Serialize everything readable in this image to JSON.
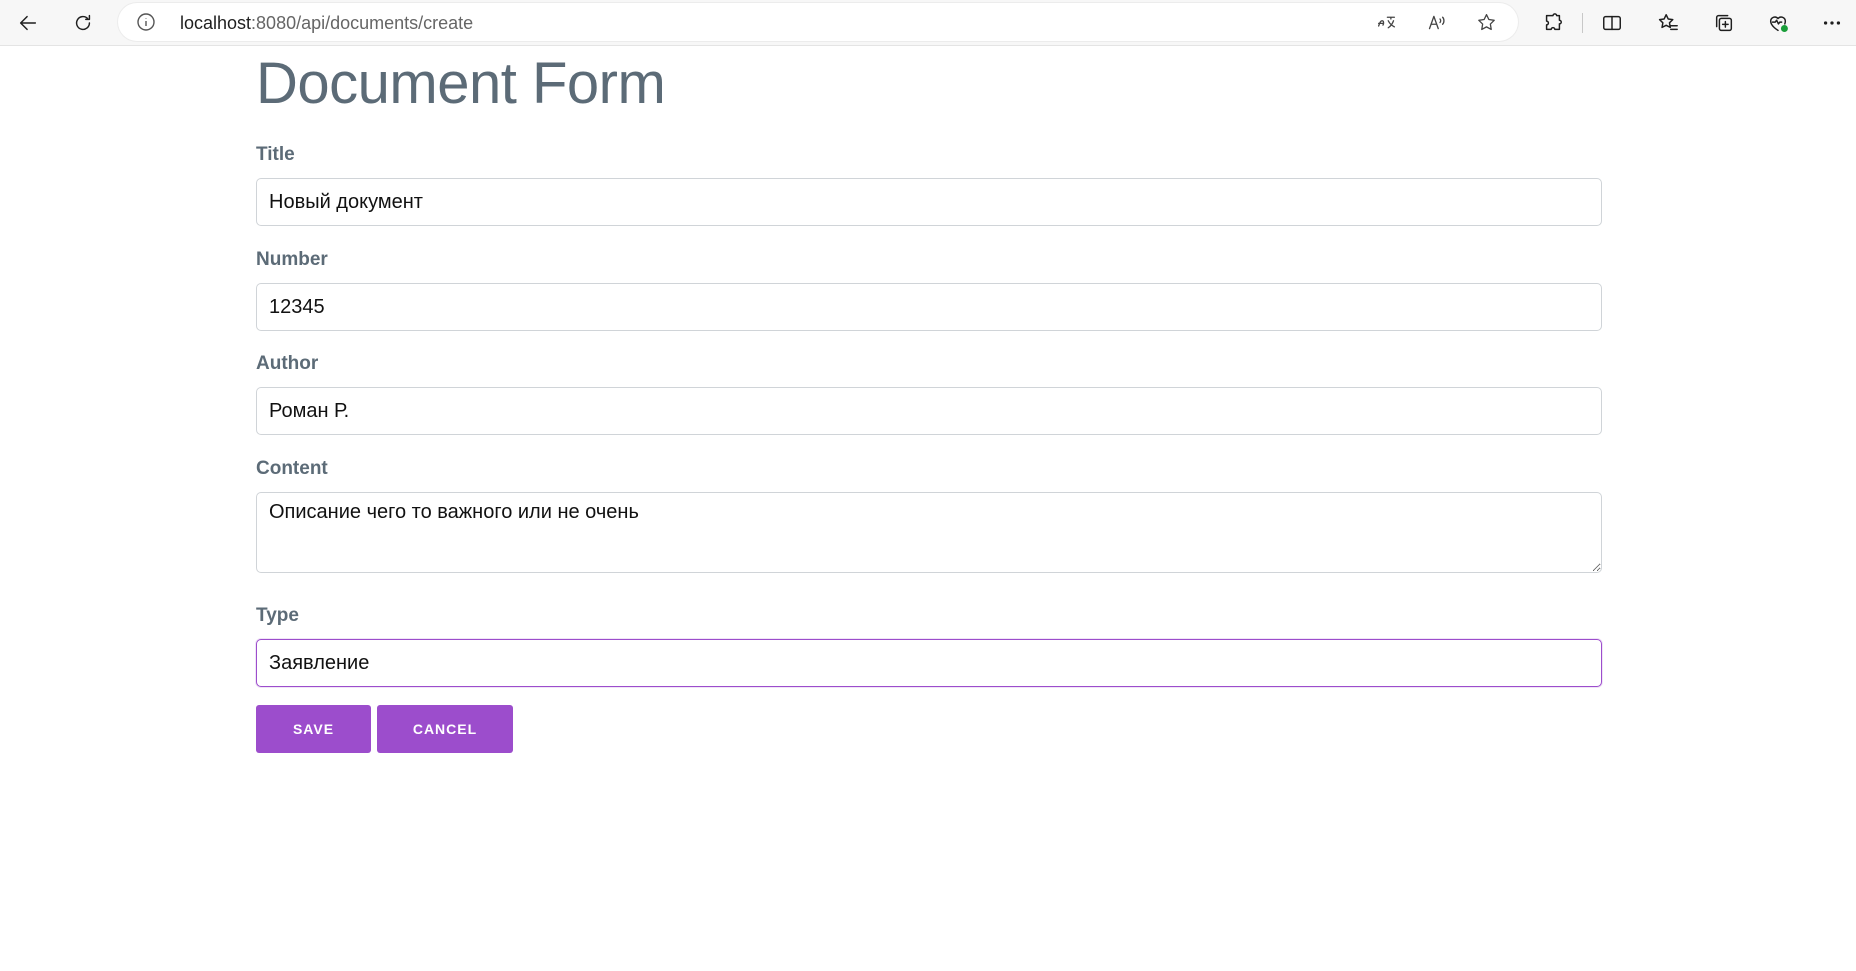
{
  "browser": {
    "url_host": "localhost",
    "url_path": ":8080/api/documents/create"
  },
  "page": {
    "title": "Document Form"
  },
  "form": {
    "title": {
      "label": "Title",
      "value": "Новый документ"
    },
    "number": {
      "label": "Number",
      "value": "12345"
    },
    "author": {
      "label": "Author",
      "value": "Роман Р."
    },
    "content": {
      "label": "Content",
      "value": "Описание чего то важного или не очень"
    },
    "type": {
      "label": "Type",
      "value": "Заявление "
    }
  },
  "buttons": {
    "save": "SAVE",
    "cancel": "CANCEL"
  },
  "colors": {
    "accent": "#9c4dcc",
    "label": "#5c6b77"
  },
  "icons": [
    "back-icon",
    "refresh-icon",
    "info-icon",
    "translate-icon",
    "read-aloud-icon",
    "favorite-star-icon",
    "extensions-icon",
    "split-screen-icon",
    "favorites-icon",
    "collections-icon",
    "browser-essentials-icon",
    "more-icon"
  ]
}
